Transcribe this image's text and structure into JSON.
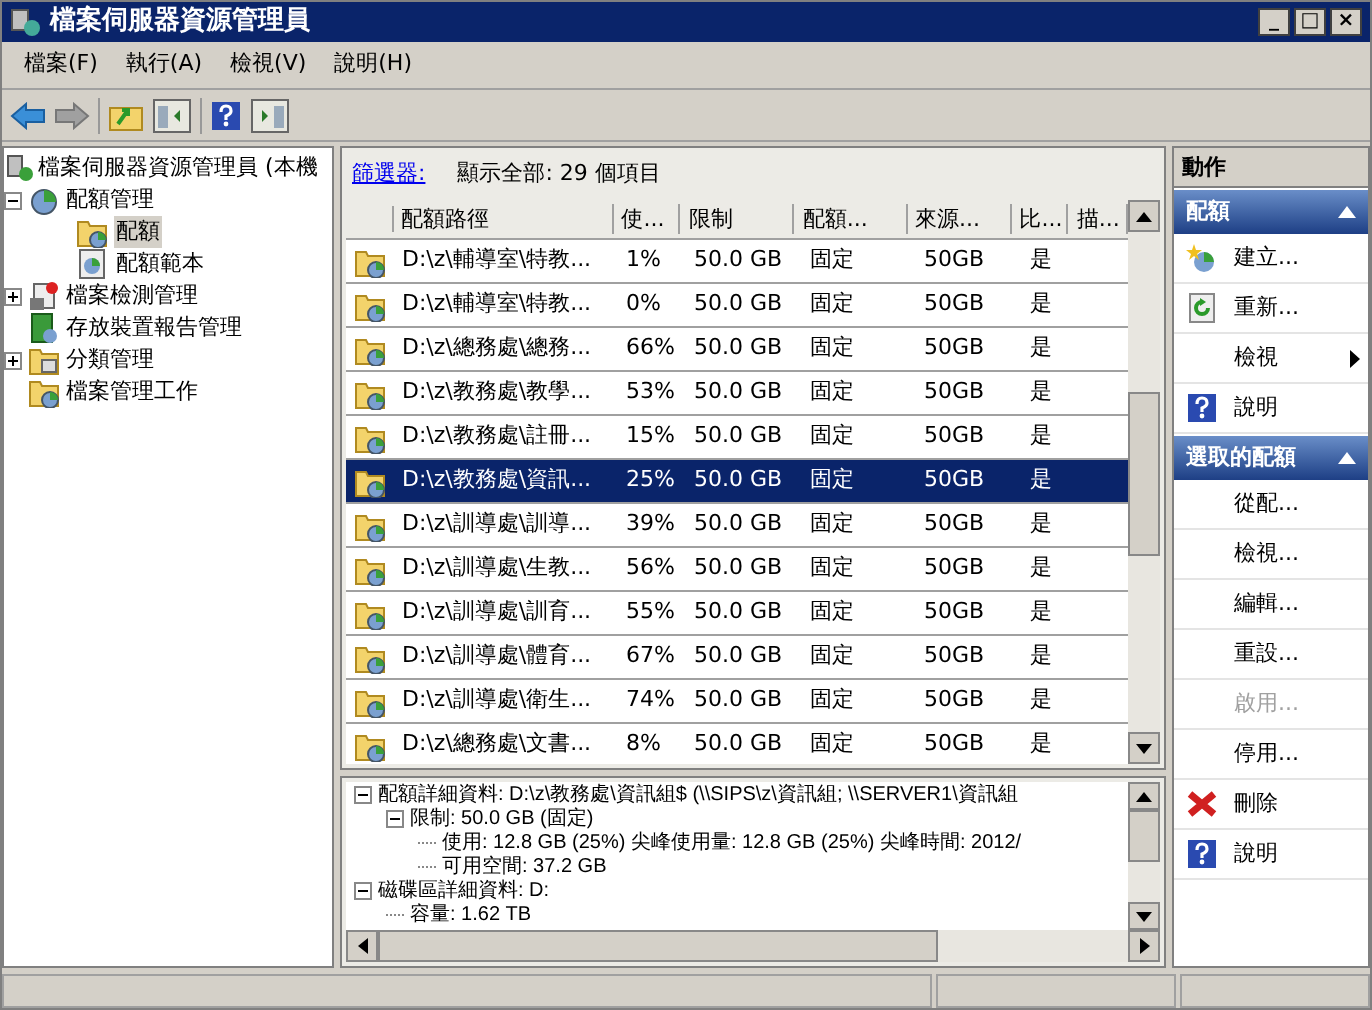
{
  "window": {
    "title": "檔案伺服器資源管理員",
    "controls": [
      "_",
      "□",
      "×"
    ]
  },
  "menu": [
    "檔案(F)",
    "執行(A)",
    "檢視(V)",
    "說明(H)"
  ],
  "tree": {
    "label": "檔案伺服器資源管理員 (本機",
    "children": [
      {
        "label": "配額管理",
        "expanded": true,
        "children": [
          {
            "label": "配額",
            "selected": true
          },
          {
            "label": "配額範本",
            "selected": false
          }
        ]
      },
      {
        "label": "檔案檢測管理",
        "expanded": false
      },
      {
        "label": "存放裝置報告管理"
      },
      {
        "label": "分類管理",
        "expanded": false
      },
      {
        "label": "檔案管理工作"
      }
    ]
  },
  "filter": {
    "link": "篩選器:",
    "summary": "顯示全部: 29 個項目"
  },
  "table": {
    "columns": [
      "配額路徑",
      "使...",
      "限制",
      "配額...",
      "來源...",
      "比...",
      "描..."
    ],
    "rows": [
      {
        "cells": [
          "D:\\z\\輔導室\\特教...",
          "1%",
          "50.0 GB",
          "固定",
          "50GB",
          "是"
        ],
        "selected": false
      },
      {
        "cells": [
          "D:\\z\\輔導室\\特教...",
          "0%",
          "50.0 GB",
          "固定",
          "50GB",
          "是"
        ],
        "selected": false
      },
      {
        "cells": [
          "D:\\z\\總務處\\總務...",
          "66%",
          "50.0 GB",
          "固定",
          "50GB",
          "是"
        ],
        "selected": false
      },
      {
        "cells": [
          "D:\\z\\教務處\\教學...",
          "53%",
          "50.0 GB",
          "固定",
          "50GB",
          "是"
        ],
        "selected": false
      },
      {
        "cells": [
          "D:\\z\\教務處\\註冊...",
          "15%",
          "50.0 GB",
          "固定",
          "50GB",
          "是"
        ],
        "selected": false
      },
      {
        "cells": [
          "D:\\z\\教務處\\資訊...",
          "25%",
          "50.0 GB",
          "固定",
          "50GB",
          "是"
        ],
        "selected": true
      },
      {
        "cells": [
          "D:\\z\\訓導處\\訓導...",
          "39%",
          "50.0 GB",
          "固定",
          "50GB",
          "是"
        ],
        "selected": false
      },
      {
        "cells": [
          "D:\\z\\訓導處\\生教...",
          "56%",
          "50.0 GB",
          "固定",
          "50GB",
          "是"
        ],
        "selected": false
      },
      {
        "cells": [
          "D:\\z\\訓導處\\訓育...",
          "55%",
          "50.0 GB",
          "固定",
          "50GB",
          "是"
        ],
        "selected": false
      },
      {
        "cells": [
          "D:\\z\\訓導處\\體育...",
          "67%",
          "50.0 GB",
          "固定",
          "50GB",
          "是"
        ],
        "selected": false
      },
      {
        "cells": [
          "D:\\z\\訓導處\\衛生...",
          "74%",
          "50.0 GB",
          "固定",
          "50GB",
          "是"
        ],
        "selected": false
      },
      {
        "cells": [
          "D:\\z\\總務處\\文書...",
          "8%",
          "50.0 GB",
          "固定",
          "50GB",
          "是"
        ],
        "selected": false
      }
    ]
  },
  "details": [
    {
      "label": "配額詳細資料: D:\\z\\教務處\\資訊組$ (\\\\SIPS\\z\\資訊組; \\\\SERVER1\\資訊組",
      "expanded": true,
      "children": [
        {
          "label": "限制: 50.0 GB (固定)",
          "expanded": true,
          "children": [
            {
              "label": "使用: 12.8 GB (25%) 尖峰使用量: 12.8 GB (25%) 尖峰時間: 2012/"
            },
            {
              "label": "可用空間: 37.2 GB"
            }
          ]
        }
      ]
    },
    {
      "label": "磁碟區詳細資料: D:",
      "expanded": true,
      "children": [
        {
          "label": "容量: 1.62 TB"
        }
      ]
    }
  ],
  "actions": {
    "title": "動作",
    "sections": [
      {
        "title": "配額",
        "items": [
          {
            "kind": "create",
            "label": "建立..."
          },
          {
            "kind": "refresh",
            "label": "重新..."
          },
          {
            "kind": "submenu",
            "label": "檢視"
          },
          {
            "kind": "help",
            "label": "說明"
          }
        ]
      },
      {
        "title": "選取的配額",
        "items": [
          {
            "kind": "plain",
            "label": "從配..."
          },
          {
            "kind": "plain",
            "label": "檢視..."
          },
          {
            "kind": "plain",
            "label": "編輯..."
          },
          {
            "kind": "plain",
            "label": "重設..."
          },
          {
            "kind": "plain",
            "label": "啟用...",
            "disabled": true
          },
          {
            "kind": "plain",
            "label": "停用..."
          },
          {
            "kind": "delete",
            "label": "刪除"
          },
          {
            "kind": "help",
            "label": "說明"
          }
        ]
      }
    ]
  }
}
